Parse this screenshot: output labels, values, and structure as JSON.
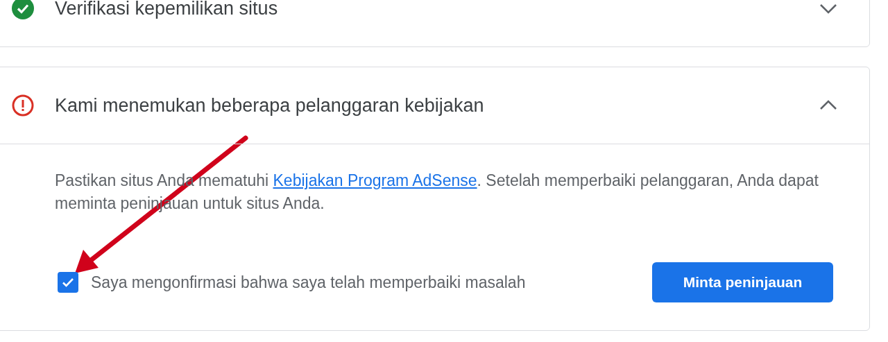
{
  "sections": [
    {
      "title": "Verifikasi kepemilikan situs",
      "kind": "success",
      "expanded": false
    },
    {
      "title": "Kami menemukan beberapa pelanggaran kebijakan",
      "kind": "error",
      "expanded": true,
      "body": {
        "text_before": "Pastikan situs Anda mematuhi ",
        "link": "Kebijakan Program AdSense",
        "text_after": ". Setelah memperbaiki pelanggaran, Anda dapat meminta peninjauan untuk situs Anda."
      },
      "confirmation": {
        "label": "Saya mengonfirmasi bahwa saya telah memperbaiki masalah",
        "checked": true
      },
      "button": "Minta peninjauan"
    }
  ]
}
